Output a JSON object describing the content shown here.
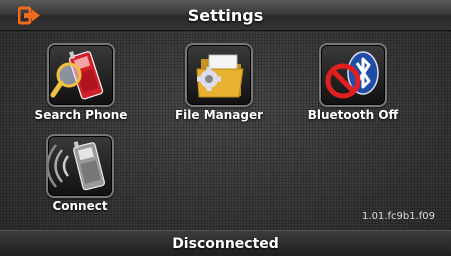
{
  "header": {
    "title": "Settings"
  },
  "tiles": [
    {
      "label": "Search Phone",
      "icon": "search-phone-icon"
    },
    {
      "label": "File Manager",
      "icon": "file-manager-icon"
    },
    {
      "label": "Bluetooth Off",
      "icon": "bluetooth-off-icon"
    },
    {
      "label": "Connect",
      "icon": "connect-icon"
    }
  ],
  "version": "1.01.fc9b1.f09",
  "status": {
    "text": "Disconnected"
  },
  "colors": {
    "accent_orange": "#f26a1b",
    "phone_red": "#d1202a",
    "bluetooth_blue": "#1f4ea8",
    "folder_yellow": "#e8b230"
  }
}
